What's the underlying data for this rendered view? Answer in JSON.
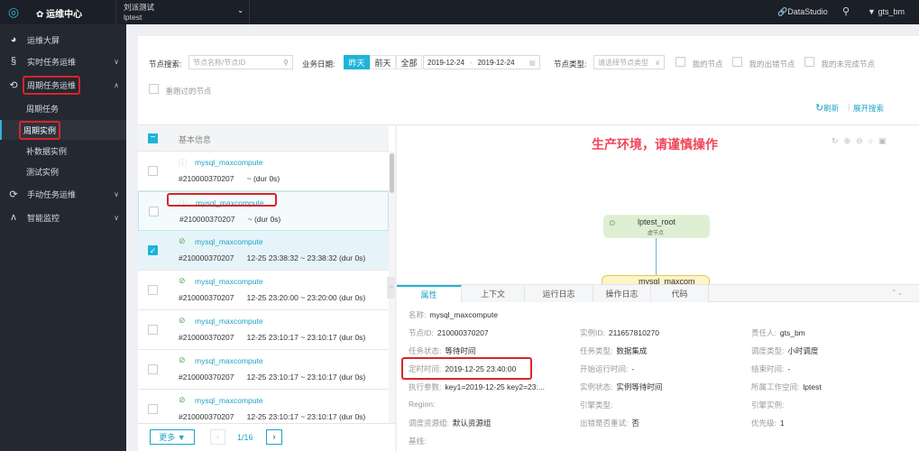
{
  "topbar": {
    "app_title": "运维中心",
    "project_name": "刘派测试",
    "project_id": "lptest",
    "datastudio": "DataStudio",
    "user": "gts_bm"
  },
  "sidebar": {
    "items": [
      {
        "label": "运维大屏",
        "icon": "pie-chart-icon"
      },
      {
        "label": "实时任务运维",
        "icon": "realtime-icon"
      },
      {
        "label": "周期任务运维",
        "icon": "cycle-icon"
      },
      {
        "label": "周期任务"
      },
      {
        "label": "周期实例"
      },
      {
        "label": "补数据实例"
      },
      {
        "label": "测试实例"
      },
      {
        "label": "手动任务运维",
        "icon": "manual-icon"
      },
      {
        "label": "智能监控",
        "icon": "monitor-icon"
      }
    ]
  },
  "filter": {
    "search_label": "节点搜索:",
    "search_placeholder": "节点名称/节点ID",
    "date_label": "业务日期:",
    "date_buttons": [
      "昨天",
      "前天",
      "全部"
    ],
    "date_start": "2019-12-24",
    "date_sep": "-",
    "date_end": "2019-12-24",
    "type_label": "节点类型:",
    "type_placeholder": "请选择节点类型",
    "checks": [
      "我的节点",
      "我的出错节点",
      "我的未完成节点",
      "重跑过的节点"
    ],
    "refresh": "刷新",
    "expand": "展开搜索"
  },
  "list": {
    "header": "基本信息",
    "rows": [
      {
        "name": "mysql_maxcompute",
        "id": "#210000370207",
        "time": "~ (dur 0s)",
        "status": "waiting",
        "checked": false
      },
      {
        "name": "mysql_maxcompute",
        "id": "#210000370207",
        "time": "~ (dur 0s)",
        "status": "waiting",
        "checked": false
      },
      {
        "name": "mysql_maxcompute",
        "id": "#210000370207",
        "time": "12-25 23:38:32 ~ 23:38:32 (dur 0s)",
        "status": "success",
        "checked": true
      },
      {
        "name": "mysql_maxcompute",
        "id": "#210000370207",
        "time": "12-25 23:20:00 ~ 23:20:00 (dur 0s)",
        "status": "success",
        "checked": false
      },
      {
        "name": "mysql_maxcompute",
        "id": "#210000370207",
        "time": "12-25 23:10:17 ~ 23:10:17 (dur 0s)",
        "status": "success",
        "checked": false
      },
      {
        "name": "mysql_maxcompute",
        "id": "#210000370207",
        "time": "12-25 23:10:17 ~ 23:10:17 (dur 0s)",
        "status": "success",
        "checked": false
      },
      {
        "name": "mysql_maxcompute",
        "id": "#210000370207",
        "time": "12-25 23:10:17 ~ 23:10:17 (dur 0s)",
        "status": "success",
        "checked": false
      }
    ],
    "more": "更多",
    "page": "1/16"
  },
  "graph": {
    "warning": "生产环境，请谨慎操作",
    "root_node": "lptest_root",
    "root_sub": "虚节点",
    "child_node": "mysql_maxcom"
  },
  "detail": {
    "tabs": [
      "属性",
      "上下文",
      "运行日志",
      "操作日志",
      "代码"
    ],
    "fields": [
      [
        "名称:",
        "mysql_maxcompute"
      ],
      [
        "节点ID:",
        "210000370207"
      ],
      [
        "实例ID:",
        "211657810270"
      ],
      [
        "责任人:",
        "gts_bm"
      ],
      [
        "任务状态:",
        "等待时间"
      ],
      [
        "任务类型:",
        "数据集成"
      ],
      [
        "调度类型:",
        "小时调度"
      ],
      [
        "定时时间:",
        "2019-12-25 23:40:00"
      ],
      [
        "开始运行时间:",
        "-"
      ],
      [
        "结束时间:",
        "-"
      ],
      [
        "执行参数:",
        "key1=2019-12-25 key2=23:..."
      ],
      [
        "实例状态:",
        "实例等待时间"
      ],
      [
        "所属工作空间:",
        "lptest"
      ],
      [
        "Region:",
        ""
      ],
      [
        "引擎类型:",
        ""
      ],
      [
        "引擎实例:",
        ""
      ],
      [
        "调度资源组:",
        "默认资源组"
      ],
      [
        "出错是否重试:",
        "否"
      ],
      [
        "优先级:",
        "1"
      ],
      [
        "基线:",
        ""
      ]
    ]
  },
  "colors": {
    "accent": "#1fa3c5",
    "highlight": "#d9242a",
    "topbar": "#1b1f27",
    "sidebar": "#242830"
  }
}
